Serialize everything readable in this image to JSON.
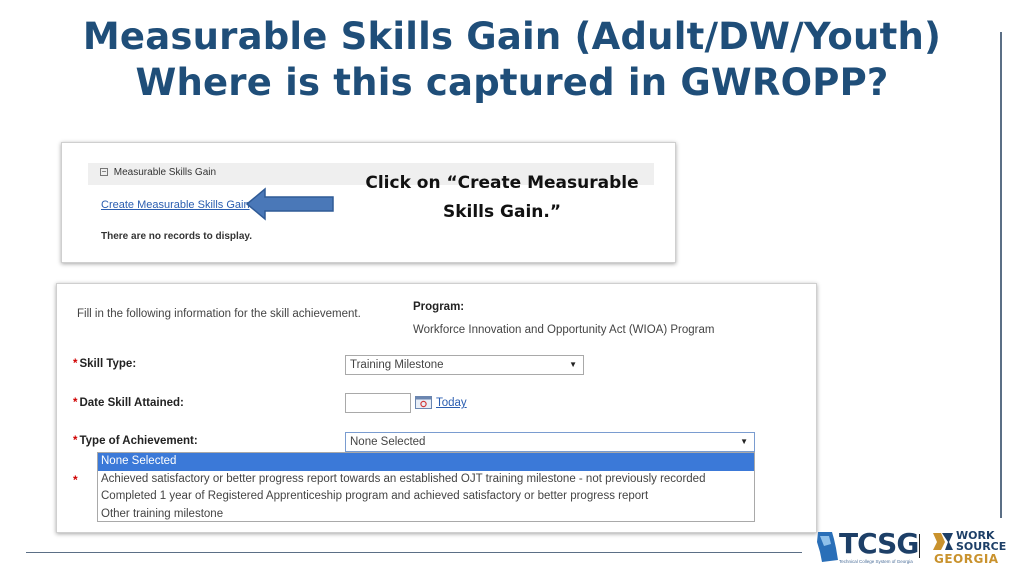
{
  "slide": {
    "title_line1": "Measurable Skills Gain (Adult/DW/Youth)",
    "title_line2": "Where is this captured in GWROPP?"
  },
  "panel1": {
    "section_header": "Measurable Skills Gain",
    "create_link": "Create Measurable Skills Gain",
    "no_records": "There are no records to display.",
    "callout_line1": "Click on “Create Measurable",
    "callout_line2": "Skills Gain.”",
    "arrow_color": "#4a78b8"
  },
  "form": {
    "intro": "Fill in the following information for the skill achievement.",
    "program_label": "Program:",
    "program_value": "Workforce Innovation and Opportunity Act (WIOA) Program",
    "required_mark": "*",
    "skill_type_label": "Skill Type:",
    "skill_type_value": "Training Milestone",
    "date_label": "Date Skill Attained:",
    "date_value": "",
    "today_link": "Today",
    "achievement_label": "Type of Achievement:",
    "achievement_value": "None Selected",
    "dropdown_options": [
      "None Selected",
      "Achieved satisfactory or better progress report towards an established OJT training milestone - not previously recorded",
      "Completed 1 year of Registered Apprenticeship program and achieved satisfactory or better progress report",
      "Other training milestone"
    ],
    "selected_color": "#3b79d8"
  },
  "logos": {
    "tcsg": "TCSG",
    "tcsg_sub": "Technical College System of Georgia",
    "ws_line1": "WORK",
    "ws_line2": "SOURCE",
    "ws_line3": "GEORGIA"
  },
  "colors": {
    "title": "#1f4e79",
    "link": "#2a5db0",
    "required": "#d00000",
    "brand_gold": "#c9922d"
  }
}
